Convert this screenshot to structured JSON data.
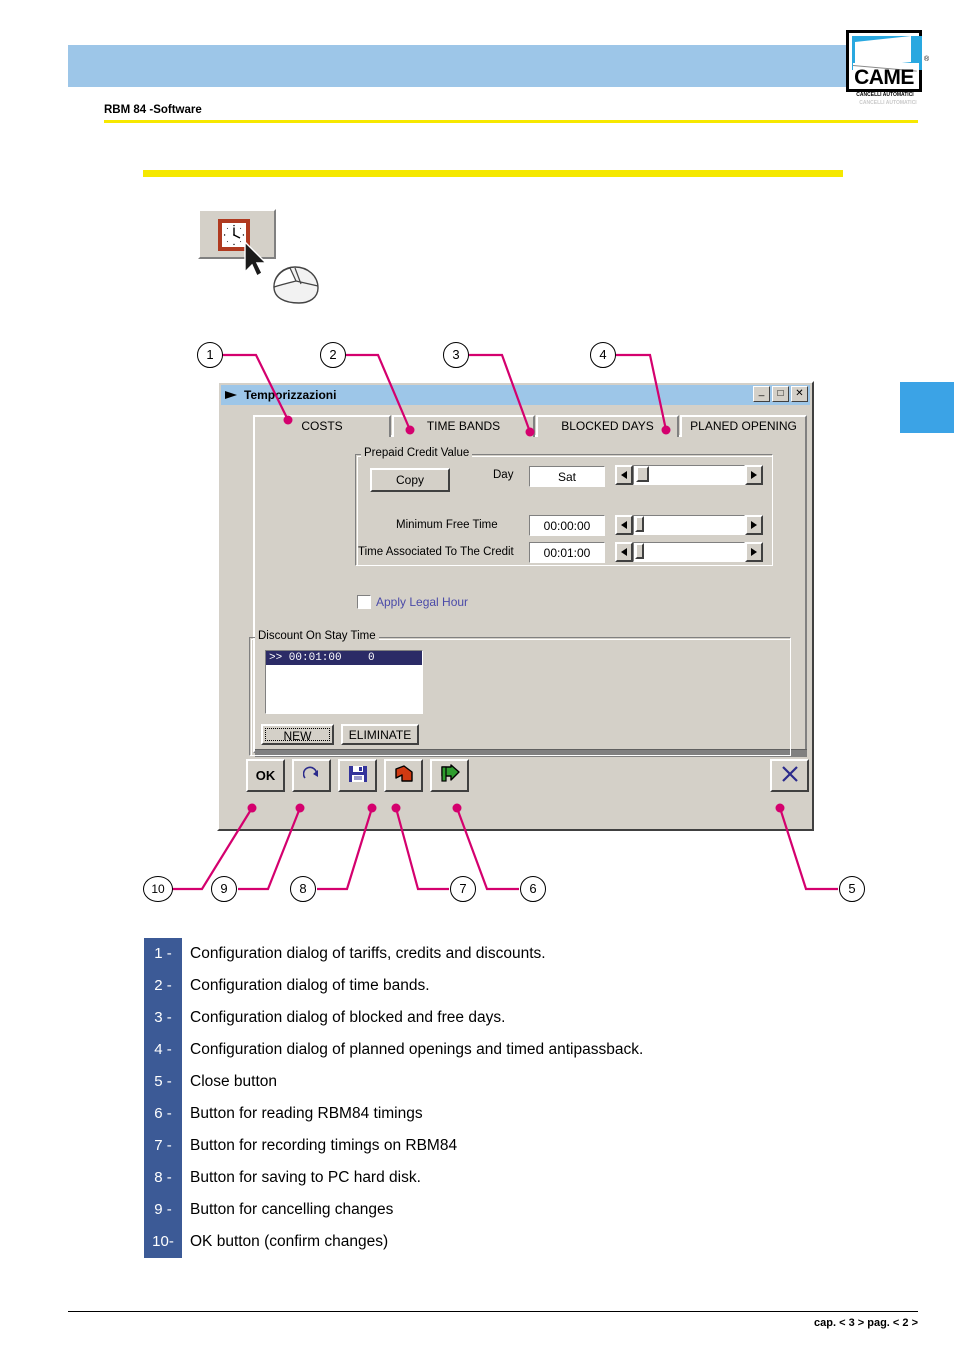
{
  "page": {
    "doc_title": "RBM 84 -Software",
    "footer": "cap. < 3 > pag. < 2 >",
    "brand": {
      "word": "CAME",
      "sub": "CANCELLI AUTOMATICI",
      "sub_shadow": "CANCELLI AUTOMATICI",
      "tm": "®"
    },
    "colors": {
      "header_band": "#9dc6e8",
      "rule_yellow": "#f5e800",
      "accent_blue": "#3ba3e6",
      "callout_pink": "#d4006e",
      "legend_num_bg": "#3c5a96",
      "dialog_face": "#d4d0c8",
      "list_selection": "#2b2b66",
      "link_blue": "#4a4aa8"
    }
  },
  "toolbar_hint": {
    "button_icon": "clock-icon",
    "cursor_icon": "mouse-pointer-icon"
  },
  "callouts": [
    {
      "n": "1"
    },
    {
      "n": "2"
    },
    {
      "n": "3"
    },
    {
      "n": "4"
    },
    {
      "n": "5"
    },
    {
      "n": "6"
    },
    {
      "n": "7"
    },
    {
      "n": "8"
    },
    {
      "n": "9"
    },
    {
      "n": "10"
    }
  ],
  "dialog": {
    "title": "Temporizzazioni",
    "title_buttons": {
      "minimize": "_",
      "maximize": "□",
      "close": "✕"
    },
    "tabs": [
      {
        "label": "COSTS",
        "selected": true
      },
      {
        "label": "TIME BANDS",
        "selected": false
      },
      {
        "label": "BLOCKED DAYS",
        "selected": false
      },
      {
        "label": "PLANED OPENING",
        "selected": false
      }
    ],
    "prepaid_group": {
      "label": "Prepaid Credit Value",
      "copy_button": "Copy",
      "rows": [
        {
          "label": "Day",
          "value": "Sat"
        },
        {
          "label": "Minimum Free Time",
          "value": "00:00:00"
        },
        {
          "label": "Time Associated To The Credit",
          "value": "00:01:00"
        }
      ]
    },
    "legal_hour": {
      "label": "Apply Legal Hour",
      "checked": false
    },
    "discount_group": {
      "label": "Discount On Stay Time",
      "rows": [
        ">> 00:01:00    0"
      ],
      "new_button": "NEW",
      "eliminate_button": "ELIMINATE"
    },
    "toolbar": [
      {
        "name": "ok-button",
        "label": "OK",
        "icon": "text"
      },
      {
        "name": "cancel-changes-button",
        "label": "",
        "icon": "redo-arrow-icon"
      },
      {
        "name": "save-to-disk-button",
        "label": "",
        "icon": "floppy-disk-icon"
      },
      {
        "name": "write-to-rbm84-button",
        "label": "",
        "icon": "red-arrow-up-icon"
      },
      {
        "name": "read-from-rbm84-button",
        "label": "",
        "icon": "green-arrow-right-icon"
      },
      {
        "name": "close-button",
        "label": "",
        "icon": "x-close-icon"
      }
    ]
  },
  "legend": [
    {
      "num": "1 -",
      "text": "Configuration dialog of tariffs, credits and discounts."
    },
    {
      "num": "2 -",
      "text": "Configuration dialog of time bands."
    },
    {
      "num": "3 -",
      "text": "Configuration dialog of blocked and free days."
    },
    {
      "num": "4 -",
      "text": "Configuration dialog of planned openings and timed antipassback."
    },
    {
      "num": "5 -",
      "text": "Close button"
    },
    {
      "num": "6 -",
      "text": "Button for reading RBM84 timings"
    },
    {
      "num": "7 -",
      "text": "Button for recording timings on RBM84"
    },
    {
      "num": "8 -",
      "text": "Button for saving to PC hard disk."
    },
    {
      "num": "9 -",
      "text": "Button for cancelling changes"
    },
    {
      "num": "10-",
      "text": "OK button (confirm changes)"
    }
  ]
}
